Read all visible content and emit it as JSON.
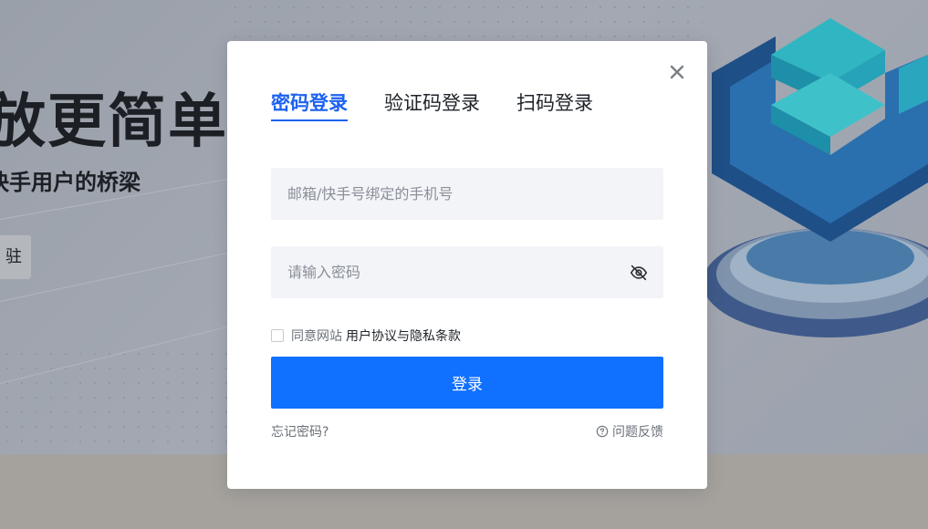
{
  "background": {
    "hero_title": "放更简单",
    "hero_subtitle": "快手用户的桥梁",
    "hero_button": "驻"
  },
  "modal": {
    "tabs": [
      {
        "label": "密码登录",
        "active": true
      },
      {
        "label": "验证码登录",
        "active": false
      },
      {
        "label": "扫码登录",
        "active": false
      }
    ],
    "account_placeholder": "邮箱/快手号绑定的手机号",
    "password_placeholder": "请输入密码",
    "agree_prefix": "同意网站",
    "agree_link": "用户协议与隐私条款",
    "login_button": "登录",
    "forgot_password": "忘记密码?",
    "feedback": "问题反馈",
    "accent_color": "#1070ff",
    "icons": [
      "close-icon",
      "eye-off-icon",
      "question-circle-icon"
    ]
  }
}
